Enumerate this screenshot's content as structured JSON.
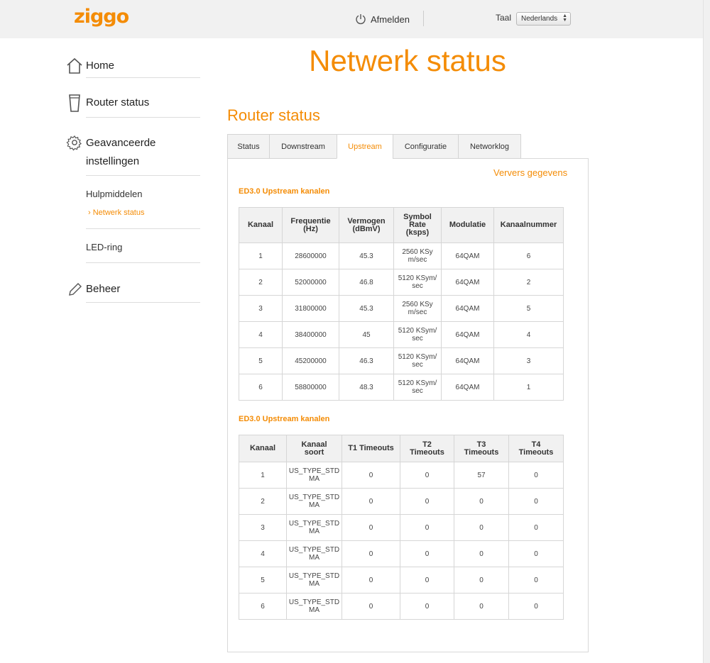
{
  "header": {
    "logo": "ziggo",
    "logout_label": "Afmelden",
    "language_label": "Taal",
    "language_selected": "Nederlands"
  },
  "sidebar": {
    "home": "Home",
    "router_status": "Router status",
    "advanced_line1": "Geavanceerde",
    "advanced_line2": "instellingen",
    "sub_tools": "Hulpmiddelen",
    "sub_network_status": "Netwerk status",
    "led_ring": "LED-ring",
    "manage": "Beheer"
  },
  "main": {
    "page_title": "Netwerk status",
    "section_title": "Router status",
    "tabs": [
      "Status",
      "Downstream",
      "Upstream",
      "Configuratie",
      "Networklog"
    ],
    "active_tab": "Upstream",
    "refresh_label": "Ververs gegevens",
    "table1": {
      "title": "ED3.0 Upstream kanalen",
      "headers": [
        [
          "Kanaal"
        ],
        [
          "Frequentie",
          "(Hz)"
        ],
        [
          "Vermogen",
          "(dBmV)"
        ],
        [
          "Symbol",
          "Rate",
          "(ksps)"
        ],
        [
          "Modulatie"
        ],
        [
          "Kanaalnummer"
        ]
      ],
      "rows": [
        [
          [
            "1"
          ],
          [
            "28600000"
          ],
          [
            "45.3"
          ],
          [
            "2560 KSy",
            "m/sec"
          ],
          [
            "64QAM"
          ],
          [
            "6"
          ]
        ],
        [
          [
            "2"
          ],
          [
            "52000000"
          ],
          [
            "46.8"
          ],
          [
            "5120 KSym/",
            "sec"
          ],
          [
            "64QAM"
          ],
          [
            "2"
          ]
        ],
        [
          [
            "3"
          ],
          [
            "31800000"
          ],
          [
            "45.3"
          ],
          [
            "2560 KSy",
            "m/sec"
          ],
          [
            "64QAM"
          ],
          [
            "5"
          ]
        ],
        [
          [
            "4"
          ],
          [
            "38400000"
          ],
          [
            "45"
          ],
          [
            "5120 KSym/",
            "sec"
          ],
          [
            "64QAM"
          ],
          [
            "4"
          ]
        ],
        [
          [
            "5"
          ],
          [
            "45200000"
          ],
          [
            "46.3"
          ],
          [
            "5120 KSym/",
            "sec"
          ],
          [
            "64QAM"
          ],
          [
            "3"
          ]
        ],
        [
          [
            "6"
          ],
          [
            "58800000"
          ],
          [
            "48.3"
          ],
          [
            "5120 KSym/",
            "sec"
          ],
          [
            "64QAM"
          ],
          [
            "1"
          ]
        ]
      ]
    },
    "table2": {
      "title": "ED3.0 Upstream kanalen",
      "headers": [
        [
          "Kanaal"
        ],
        [
          "Kanaal",
          "soort"
        ],
        [
          "T1 Timeouts"
        ],
        [
          "T2",
          "Timeouts"
        ],
        [
          "T3",
          "Timeouts"
        ],
        [
          "T4",
          "Timeouts"
        ]
      ],
      "rows": [
        [
          [
            "1"
          ],
          [
            "US_TYPE_STD",
            "MA"
          ],
          [
            "0"
          ],
          [
            "0"
          ],
          [
            "57"
          ],
          [
            "0"
          ]
        ],
        [
          [
            "2"
          ],
          [
            "US_TYPE_STD",
            "MA"
          ],
          [
            "0"
          ],
          [
            "0"
          ],
          [
            "0"
          ],
          [
            "0"
          ]
        ],
        [
          [
            "3"
          ],
          [
            "US_TYPE_STD",
            "MA"
          ],
          [
            "0"
          ],
          [
            "0"
          ],
          [
            "0"
          ],
          [
            "0"
          ]
        ],
        [
          [
            "4"
          ],
          [
            "US_TYPE_STD",
            "MA"
          ],
          [
            "0"
          ],
          [
            "0"
          ],
          [
            "0"
          ],
          [
            "0"
          ]
        ],
        [
          [
            "5"
          ],
          [
            "US_TYPE_STD",
            "MA"
          ],
          [
            "0"
          ],
          [
            "0"
          ],
          [
            "0"
          ],
          [
            "0"
          ]
        ],
        [
          [
            "6"
          ],
          [
            "US_TYPE_STD",
            "MA"
          ],
          [
            "0"
          ],
          [
            "0"
          ],
          [
            "0"
          ],
          [
            "0"
          ]
        ]
      ]
    }
  },
  "icons": {
    "power": "power-icon",
    "home": "home-icon",
    "router": "router-icon",
    "settings": "gear-icon",
    "manage": "pencil-icon",
    "submenu_active": "chevron-right-icon"
  },
  "colors": {
    "accent": "#f48c06",
    "header_bg": "#f1f1f1",
    "table_header_bg": "#f1f1f1",
    "border": "#d6d6d6"
  }
}
